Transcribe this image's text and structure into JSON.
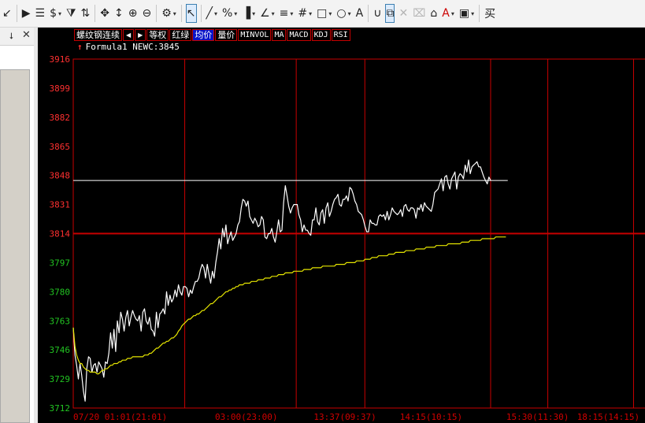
{
  "toolbar": {
    "items": [
      {
        "name": "cursor-edge-icon",
        "glyph": "↙",
        "dd": false
      },
      {
        "name": "sep"
      },
      {
        "name": "play-icon",
        "glyph": "▶",
        "dd": false
      },
      {
        "name": "document-icon",
        "glyph": "☰",
        "dd": false
      },
      {
        "name": "currency-icon",
        "glyph": "$",
        "dd": true
      },
      {
        "name": "filter-icon",
        "glyph": "⧩",
        "dd": false
      },
      {
        "name": "sort-icon",
        "glyph": "⇅",
        "dd": false
      },
      {
        "name": "sep"
      },
      {
        "name": "move-icon",
        "glyph": "✥",
        "dd": false
      },
      {
        "name": "fit-height-icon",
        "glyph": "↕",
        "dd": false
      },
      {
        "name": "zoom-in-icon",
        "glyph": "⊕",
        "dd": false
      },
      {
        "name": "zoom-out-icon",
        "glyph": "⊖",
        "dd": false
      },
      {
        "name": "sep"
      },
      {
        "name": "gear-icon",
        "glyph": "⚙",
        "dd": true
      },
      {
        "name": "sep"
      },
      {
        "name": "pointer-icon",
        "glyph": "↖",
        "dd": false,
        "selected": true
      },
      {
        "name": "sep"
      },
      {
        "name": "line-tool-icon",
        "glyph": "╱",
        "dd": true
      },
      {
        "name": "percent-tool-icon",
        "glyph": "%",
        "dd": true
      },
      {
        "name": "bars-tool-icon",
        "glyph": "▐",
        "dd": true
      },
      {
        "name": "angle-tool-icon",
        "glyph": "∠",
        "dd": true
      },
      {
        "name": "fibonacci-tool-icon",
        "glyph": "≡",
        "dd": true
      },
      {
        "name": "grid-tool-icon",
        "glyph": "#",
        "dd": true
      },
      {
        "name": "rectangle-tool-icon",
        "glyph": "□",
        "dd": true
      },
      {
        "name": "ellipse-tool-icon",
        "glyph": "○",
        "dd": true
      },
      {
        "name": "text-tool-icon",
        "glyph": "A",
        "dd": false
      },
      {
        "name": "sep"
      },
      {
        "name": "magnet-icon",
        "glyph": "∪",
        "dd": false
      },
      {
        "name": "copy-icon",
        "glyph": "⧉",
        "dd": false,
        "selected": true
      },
      {
        "name": "close-icon",
        "glyph": "✕",
        "dd": false,
        "disabled": true
      },
      {
        "name": "trash-icon",
        "glyph": "⌧",
        "dd": false,
        "disabled": true
      },
      {
        "name": "lock-icon",
        "glyph": "⌂",
        "dd": false
      },
      {
        "name": "font-color-icon",
        "glyph": "A",
        "dd": true,
        "color": "#cc0000"
      },
      {
        "name": "save-template-icon",
        "glyph": "▣",
        "dd": true
      },
      {
        "name": "sep"
      },
      {
        "name": "buy-label",
        "glyph": "买",
        "dd": false
      }
    ]
  },
  "left_panel": {
    "pin_glyph": "⭣",
    "close_glyph": "✕"
  },
  "chart_header": {
    "symbol": "螺纹钢连续",
    "prev_glyph": "◀",
    "next_glyph": "▶",
    "buttons": [
      {
        "label": "等权",
        "mono": false,
        "hl": false
      },
      {
        "label": "红绿",
        "mono": false,
        "hl": false
      },
      {
        "label": "均价",
        "mono": false,
        "hl": true
      },
      {
        "label": "量价",
        "mono": false,
        "hl": false
      },
      {
        "label": "MINVOL",
        "mono": true,
        "hl": false
      },
      {
        "label": "MA",
        "mono": true,
        "hl": false
      },
      {
        "label": "MACD",
        "mono": true,
        "hl": false
      },
      {
        "label": "KDJ",
        "mono": true,
        "hl": false
      },
      {
        "label": "RSI",
        "mono": true,
        "hl": false
      }
    ],
    "formula_marker": "↑",
    "formula_text": "Formula1 NEWC:3845"
  },
  "colors": {
    "up": "#ff3030",
    "down": "#22c422",
    "grid": "#c80000",
    "price": "#ffffff",
    "avg": "#e6e600",
    "ref": "#ffffff"
  },
  "chart_data": {
    "type": "line",
    "title": "",
    "y_ticks": [
      3916,
      3899,
      3882,
      3865,
      3848,
      3831,
      3814,
      3797,
      3780,
      3763,
      3746,
      3729,
      3712
    ],
    "ylim": [
      3712,
      3916
    ],
    "prev_close": 3814,
    "last": 3845,
    "reference_level": 3845,
    "x_labels": [
      "07/20 01:01(21:01)",
      "03:00(23:00)",
      "13:37(09:37)",
      "14:15(10:15)",
      "15:30(11:30)",
      "18:15(14:15)"
    ],
    "grid": true,
    "series": [
      {
        "values": [
          3759,
          3743,
          3737,
          3729,
          3738,
          3731,
          3722,
          3716,
          3735,
          3742,
          3741,
          3733,
          3737,
          3738,
          3733,
          3739,
          3737,
          3735,
          3730,
          3739,
          3738,
          3744,
          3756,
          3747,
          3758,
          3745,
          3763,
          3756,
          3768,
          3764,
          3757,
          3765,
          3769,
          3760,
          3765,
          3769,
          3766,
          3764,
          3763,
          3766,
          3757,
          3768,
          3770,
          3763,
          3761,
          3765,
          3758,
          3757,
          3754,
          3768,
          3759,
          3767,
          3768,
          3770,
          3767,
          3780,
          3772,
          3778,
          3774,
          3776,
          3781,
          3777,
          3784,
          3780,
          3778,
          3783,
          3783,
          3782,
          3777,
          3781,
          3779,
          3783,
          3786,
          3786,
          3788,
          3793,
          3796,
          3794,
          3788,
          3796,
          3790,
          3785,
          3792,
          3788,
          3797,
          3803,
          3811,
          3805,
          3817,
          3812,
          3819,
          3808,
          3812,
          3815,
          3810,
          3812,
          3814,
          3819,
          3821,
          3829,
          3834,
          3833,
          3830,
          3833,
          3824,
          3822,
          3820,
          3823,
          3821,
          3818,
          3819,
          3824,
          3822,
          3812,
          3811,
          3814,
          3814,
          3817,
          3812,
          3809,
          3815,
          3822,
          3815,
          3816,
          3832,
          3842,
          3836,
          3830,
          3826,
          3829,
          3831,
          3831,
          3831,
          3825,
          3822,
          3815,
          3819,
          3816,
          3816,
          3814,
          3813,
          3822,
          3822,
          3829,
          3821,
          3819,
          3826,
          3828,
          3820,
          3829,
          3832,
          3824,
          3827,
          3831,
          3834,
          3835,
          3837,
          3831,
          3830,
          3834,
          3834,
          3836,
          3833,
          3841,
          3840,
          3837,
          3833,
          3831,
          3827,
          3826,
          3825,
          3822,
          3818,
          3815,
          3815,
          3822,
          3820,
          3820,
          3819,
          3819,
          3824,
          3825,
          3824,
          3825,
          3822,
          3827,
          3822,
          3825,
          3829,
          3827,
          3826,
          3825,
          3826,
          3828,
          3824,
          3830,
          3831,
          3828,
          3827,
          3829,
          3829,
          3828,
          3823,
          3829,
          3828,
          3831,
          3827,
          3832,
          3830,
          3829,
          3828,
          3827,
          3831,
          3838,
          3839,
          3840,
          3843,
          3846,
          3839,
          3847,
          3848,
          3843,
          3840,
          3846,
          3848,
          3850,
          3840,
          3847,
          3849,
          3848,
          3846,
          3854,
          3850,
          3857,
          3849,
          3853,
          3854,
          3855,
          3856,
          3853,
          3853,
          3850,
          3847,
          3845,
          3843,
          3847,
          3845
        ],
        "color": "#ffffff"
      },
      {
        "values": [
          3759,
          3748,
          3743,
          3740,
          3738,
          3738,
          3736,
          3735,
          3734,
          3734,
          3733,
          3733,
          3733,
          3733,
          3732,
          3732,
          3733,
          3734,
          3734,
          3735,
          3735,
          3736,
          3737,
          3737,
          3738,
          3738,
          3738,
          3739,
          3739,
          3740,
          3740,
          3740,
          3741,
          3741,
          3741,
          3742,
          3742,
          3742,
          3742,
          3742,
          3742,
          3742,
          3743,
          3743,
          3743,
          3744,
          3744,
          3745,
          3746,
          3747,
          3747,
          3748,
          3749,
          3750,
          3750,
          3751,
          3751,
          3752,
          3753,
          3753,
          3754,
          3755,
          3757,
          3758,
          3760,
          3761,
          3762,
          3763,
          3764,
          3764,
          3765,
          3766,
          3766,
          3767,
          3767,
          3768,
          3769,
          3769,
          3770,
          3771,
          3772,
          3773,
          3773,
          3774,
          3775,
          3776,
          3777,
          3777,
          3778,
          3779,
          3780,
          3780,
          3781,
          3781,
          3782,
          3782,
          3783,
          3783,
          3784,
          3784,
          3784,
          3785,
          3785,
          3785,
          3785,
          3786,
          3786,
          3786,
          3786,
          3787,
          3787,
          3787,
          3787,
          3788,
          3788,
          3788,
          3788,
          3789,
          3789,
          3789,
          3789,
          3790,
          3790,
          3790,
          3790,
          3791,
          3791,
          3791,
          3791,
          3791,
          3792,
          3792,
          3792,
          3792,
          3792,
          3792,
          3793,
          3793,
          3793,
          3793,
          3793,
          3794,
          3794,
          3794,
          3794,
          3794,
          3794,
          3795,
          3795,
          3795,
          3795,
          3795,
          3795,
          3795,
          3795,
          3796,
          3796,
          3796,
          3796,
          3796,
          3796,
          3797,
          3797,
          3797,
          3797,
          3797,
          3797,
          3798,
          3798,
          3798,
          3798,
          3798,
          3799,
          3799,
          3799,
          3799,
          3800,
          3800,
          3800,
          3800,
          3801,
          3801,
          3801,
          3801,
          3801,
          3801,
          3802,
          3802,
          3802,
          3802,
          3803,
          3803,
          3803,
          3803,
          3803,
          3803,
          3804,
          3804,
          3804,
          3804,
          3804,
          3804,
          3805,
          3805,
          3805,
          3805,
          3805,
          3805,
          3806,
          3806,
          3806,
          3806,
          3806,
          3806,
          3807,
          3807,
          3807,
          3807,
          3807,
          3807,
          3807,
          3808,
          3808,
          3808,
          3808,
          3808,
          3808,
          3808,
          3808,
          3809,
          3809,
          3809,
          3809,
          3809,
          3810,
          3810,
          3810,
          3810,
          3810,
          3810,
          3810,
          3811,
          3811,
          3811,
          3811,
          3811,
          3811,
          3811,
          3811,
          3812,
          3812,
          3812,
          3812,
          3812,
          3812,
          3812
        ],
        "color": "#e6e600"
      }
    ]
  }
}
